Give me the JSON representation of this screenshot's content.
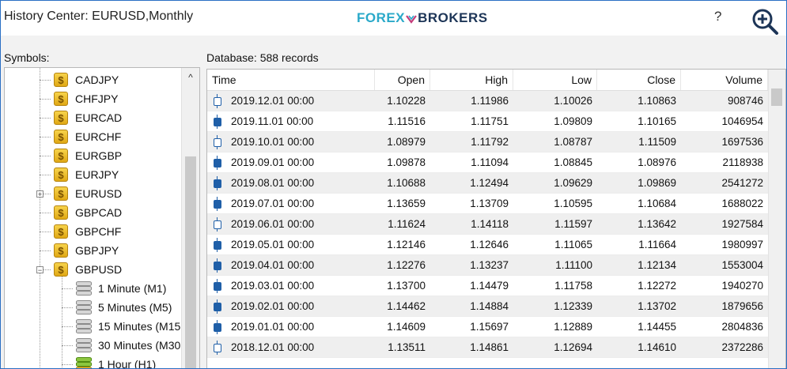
{
  "window": {
    "title": "History Center: EURUSD,Monthly",
    "help": "?"
  },
  "logo": {
    "part1": "FOREX",
    "part2": "BROKERS"
  },
  "colors": {
    "accent": "#2a6fc4",
    "logo_blue": "#2aa9c9",
    "logo_dark": "#1d3557",
    "coin": "#f0c030",
    "candle": "#1f5fa8"
  },
  "symbols_label": "Symbols:",
  "database_label": "Database: 588 records",
  "tree": {
    "symbols": [
      "CADJPY",
      "CHFJPY",
      "EURCAD",
      "EURCHF",
      "EURGBP",
      "EURJPY",
      "EURUSD",
      "GBPCAD",
      "GBPCHF",
      "GBPJPY",
      "GBPUSD"
    ],
    "expanded_symbol": "GBPUSD",
    "collapsed_expander": "+",
    "expanded_expander": "−",
    "timeframes": [
      "1 Minute (M1)",
      "5 Minutes (M5)",
      "15 Minutes (M15",
      "30 Minutes (M30",
      "1 Hour (H1)"
    ],
    "scroll_up": "^"
  },
  "table": {
    "columns": [
      "Time",
      "Open",
      "High",
      "Low",
      "Close",
      "Volume"
    ],
    "rows": [
      {
        "time": "2019.12.01 00:00",
        "open": "1.10228",
        "high": "1.11986",
        "low": "1.10026",
        "close": "1.10863",
        "volume": "908746",
        "dir": "bull"
      },
      {
        "time": "2019.11.01 00:00",
        "open": "1.11516",
        "high": "1.11751",
        "low": "1.09809",
        "close": "1.10165",
        "volume": "1046954",
        "dir": "bear"
      },
      {
        "time": "2019.10.01 00:00",
        "open": "1.08979",
        "high": "1.11792",
        "low": "1.08787",
        "close": "1.11509",
        "volume": "1697536",
        "dir": "bull"
      },
      {
        "time": "2019.09.01 00:00",
        "open": "1.09878",
        "high": "1.11094",
        "low": "1.08845",
        "close": "1.08976",
        "volume": "2118938",
        "dir": "bear"
      },
      {
        "time": "2019.08.01 00:00",
        "open": "1.10688",
        "high": "1.12494",
        "low": "1.09629",
        "close": "1.09869",
        "volume": "2541272",
        "dir": "bear"
      },
      {
        "time": "2019.07.01 00:00",
        "open": "1.13659",
        "high": "1.13709",
        "low": "1.10595",
        "close": "1.10684",
        "volume": "1688022",
        "dir": "bear"
      },
      {
        "time": "2019.06.01 00:00",
        "open": "1.11624",
        "high": "1.14118",
        "low": "1.11597",
        "close": "1.13642",
        "volume": "1927584",
        "dir": "bull"
      },
      {
        "time": "2019.05.01 00:00",
        "open": "1.12146",
        "high": "1.12646",
        "low": "1.11065",
        "close": "1.11664",
        "volume": "1980997",
        "dir": "bear"
      },
      {
        "time": "2019.04.01 00:00",
        "open": "1.12276",
        "high": "1.13237",
        "low": "1.11100",
        "close": "1.12134",
        "volume": "1553004",
        "dir": "bear"
      },
      {
        "time": "2019.03.01 00:00",
        "open": "1.13700",
        "high": "1.14479",
        "low": "1.11758",
        "close": "1.12272",
        "volume": "1940270",
        "dir": "bear"
      },
      {
        "time": "2019.02.01 00:00",
        "open": "1.14462",
        "high": "1.14884",
        "low": "1.12339",
        "close": "1.13702",
        "volume": "1879656",
        "dir": "bear"
      },
      {
        "time": "2019.01.01 00:00",
        "open": "1.14609",
        "high": "1.15697",
        "low": "1.12889",
        "close": "1.14455",
        "volume": "2804836",
        "dir": "bear"
      },
      {
        "time": "2018.12.01 00:00",
        "open": "1.13511",
        "high": "1.14861",
        "low": "1.12694",
        "close": "1.14610",
        "volume": "2372286",
        "dir": "bull"
      }
    ]
  }
}
